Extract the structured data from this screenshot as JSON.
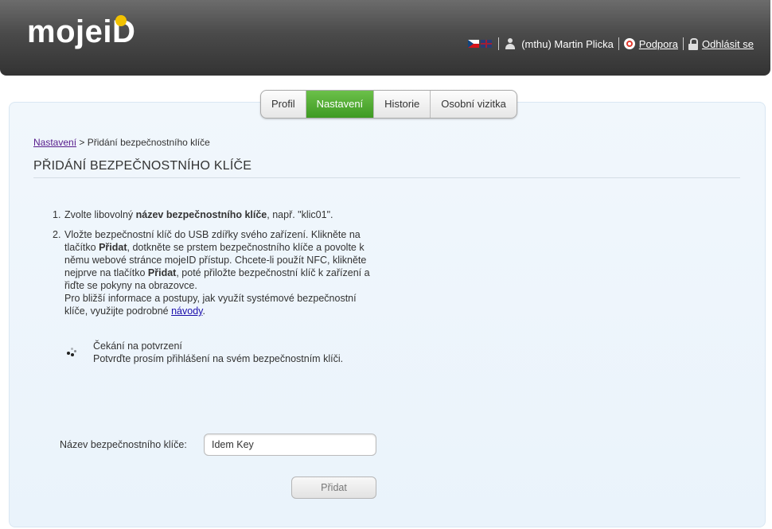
{
  "header": {
    "logo_text": "moje",
    "logo_id_text": "iD",
    "user_label": "(mthu) Martin Plicka",
    "support_label": "Podpora",
    "logout_label": "Odhlásit se"
  },
  "tabs": [
    {
      "label": "Profil",
      "active": false
    },
    {
      "label": "Nastavení",
      "active": true
    },
    {
      "label": "Historie",
      "active": false
    },
    {
      "label": "Osobní vizitka",
      "active": false
    }
  ],
  "breadcrumb": {
    "link": "Nastavení",
    "separator": " > ",
    "current": "Přidání bezpečnostního klíče"
  },
  "page_title": "PŘIDÁNÍ BEZPEČNOSTNÍHO KLÍČE",
  "steps": [
    {
      "num": "1.",
      "t1": "Zvolte libovolný ",
      "b1": "název bezpečnostního klíče",
      "t2": ", např. \"klic01\"."
    },
    {
      "num": "2.",
      "t1": "Vložte bezpečnostní klíč do USB zdířky svého zařízení. Klikněte na tlačítko ",
      "b1": "Přidat",
      "t2": ", dotkněte se prstem bezpečnostního klíče a povolte k němu webové stránce mojeID přístup. Chcete-li použít NFC, klikněte nejprve na tlačítko ",
      "b2": "Přidat",
      "t3": ", poté přiložte bezpečnostní klíč k zařízení a řiďte se pokyny na obrazovce.",
      "t4": "Pro bližší informace a postupy, jak využít systémové bezpečnostní klíče, využijte podrobné ",
      "link": "návody",
      "t5": "."
    }
  ],
  "waiting": {
    "title": "Čekání na potvrzení",
    "text": "Potvrďte prosím přihlášení na svém bezpečnostním klíči."
  },
  "form": {
    "label": "Název bezpečnostního klíče:",
    "value": "Idem Key",
    "button": "Přidat"
  },
  "colors": {
    "active_tab": "#4ea82d",
    "panel_bg": "#eef5fb",
    "header_bg": "#4a4a4a"
  }
}
